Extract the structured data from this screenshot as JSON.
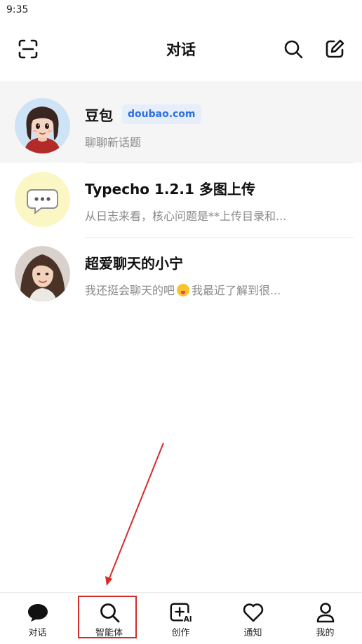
{
  "status_bar": {
    "time": "9:35"
  },
  "header": {
    "title": "对话",
    "icons": {
      "left": "scan-icon",
      "search": "search-icon",
      "new_chat": "edit-icon"
    }
  },
  "conversations": [
    {
      "name": "豆包",
      "badge": "doubao.com",
      "preview": "聊聊新话题",
      "avatar": "doubao-avatar",
      "active": true
    },
    {
      "name": "Typecho 1.2.1 多图上传",
      "preview": "从日志来看，核心问题是**上传目录和...",
      "avatar": "chat-bubble-avatar"
    },
    {
      "name": "超爱聊天的小宁",
      "preview_before": "我还挺会聊天的吧",
      "preview_after": "我最近了解到很...",
      "avatar": "xiaoning-avatar"
    }
  ],
  "tabs": [
    {
      "label": "对话",
      "icon": "chat-bubble-icon",
      "selected": true
    },
    {
      "label": "智能体",
      "icon": "search-icon"
    },
    {
      "label": "创作",
      "icon": "ai-create-icon"
    },
    {
      "label": "通知",
      "icon": "heart-icon"
    },
    {
      "label": "我的",
      "icon": "person-icon"
    }
  ],
  "colors": {
    "badge_text": "#2f6fe0",
    "badge_bg": "#e6eefc",
    "annotation": "#d42b2b",
    "active_row": "#f5f5f5"
  }
}
